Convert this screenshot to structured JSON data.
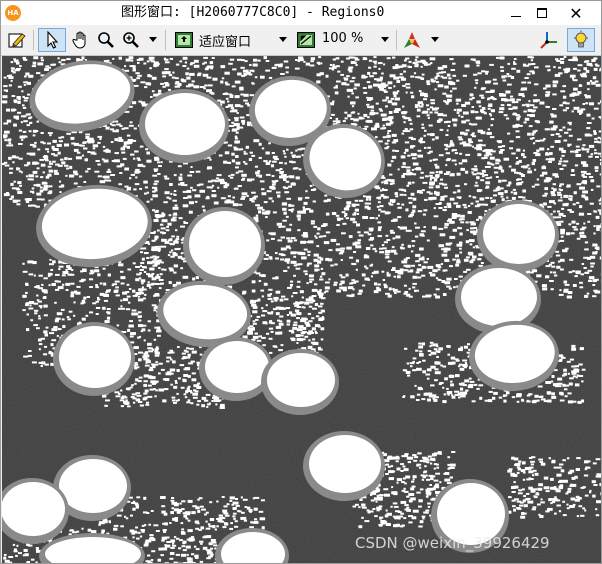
{
  "window": {
    "title": "图形窗口: [H2060777C8C0] - Regions0",
    "logo_text": "HA"
  },
  "toolbar": {
    "fit_label": "适应窗口",
    "zoom_value": "100 %",
    "tools": [
      "edit-icon",
      "pointer-icon",
      "hand-icon",
      "magnifier-icon",
      "zoom-in-icon",
      "fit-window-icon",
      "zoom-percent-icon",
      "color-tool-icon",
      "axes-icon",
      "lightbulb-icon"
    ]
  },
  "image": {
    "background_color": "#3c3c3c",
    "region_color": "#ffffff",
    "blob_gray": "#8a8a8a"
  },
  "watermark": "CSDN @weixin_39926429"
}
